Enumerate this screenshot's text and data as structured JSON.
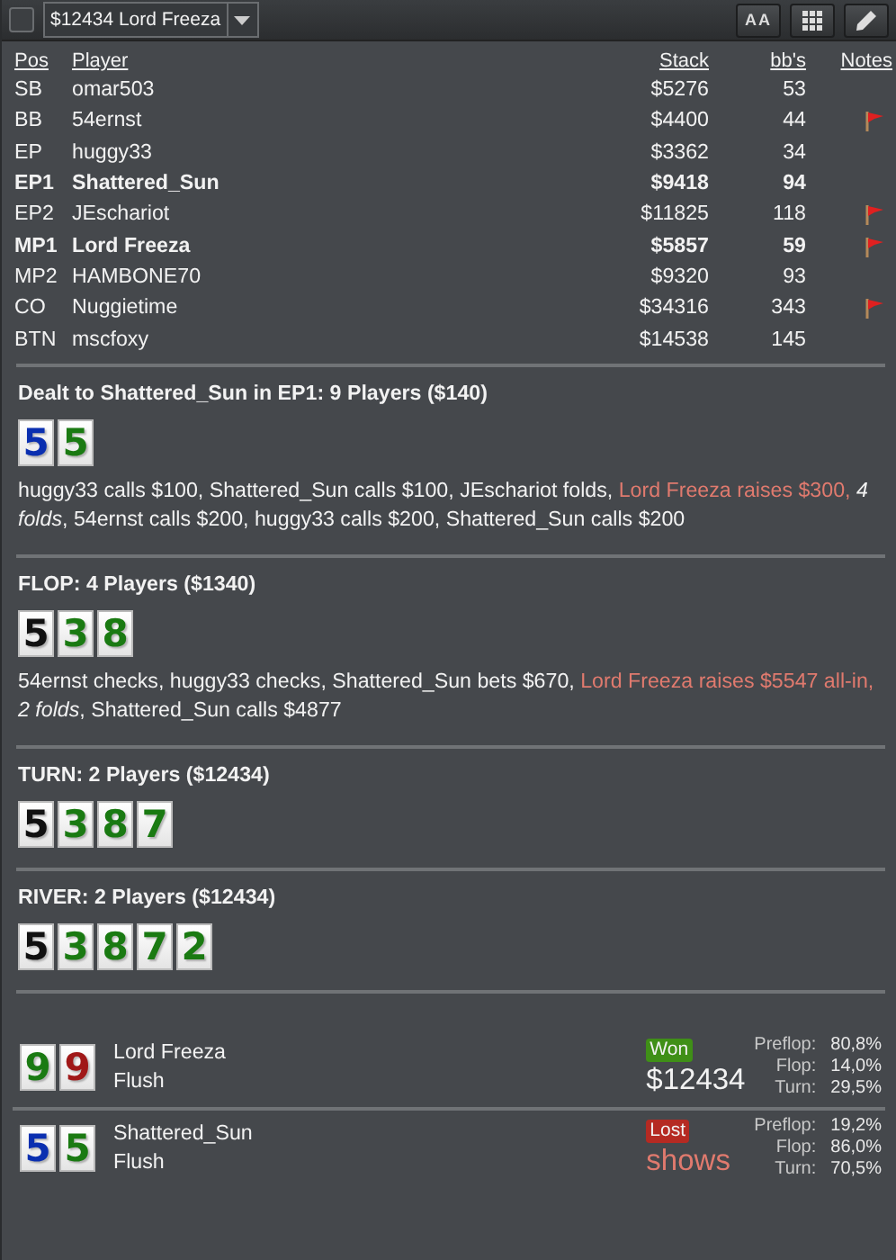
{
  "toolbar": {
    "checkbox": {
      "checked": false
    },
    "hand_select": {
      "value": "$12434 Lord Freeza"
    },
    "font_button": "AA"
  },
  "players": {
    "columns": [
      "Pos",
      "Player",
      "Stack",
      "bb's",
      "Notes"
    ],
    "rows": [
      {
        "pos": "SB",
        "player": "omar503",
        "stack": "$5276",
        "bbs": "53",
        "flagged": false,
        "highlighted": false
      },
      {
        "pos": "BB",
        "player": "54ernst",
        "stack": "$4400",
        "bbs": "44",
        "flagged": true,
        "highlighted": false
      },
      {
        "pos": "EP",
        "player": "huggy33",
        "stack": "$3362",
        "bbs": "34",
        "flagged": false,
        "highlighted": false
      },
      {
        "pos": "EP1",
        "player": "Shattered_Sun",
        "stack": "$9418",
        "bbs": "94",
        "flagged": false,
        "highlighted": true
      },
      {
        "pos": "EP2",
        "player": "JEschariot",
        "stack": "$11825",
        "bbs": "118",
        "flagged": true,
        "highlighted": false
      },
      {
        "pos": "MP1",
        "player": "Lord Freeza",
        "stack": "$5857",
        "bbs": "59",
        "flagged": true,
        "highlighted": true
      },
      {
        "pos": "MP2",
        "player": "HAMBONE70",
        "stack": "$9320",
        "bbs": "93",
        "flagged": false,
        "highlighted": false
      },
      {
        "pos": "CO",
        "player": "Nuggietime",
        "stack": "$34316",
        "bbs": "343",
        "flagged": true,
        "highlighted": false
      },
      {
        "pos": "BTN",
        "player": "mscfoxy",
        "stack": "$14538",
        "bbs": "145",
        "flagged": false,
        "highlighted": false
      }
    ]
  },
  "streets": [
    {
      "title": "Dealt to Shattered_Sun in EP1: 9 Players ($140)",
      "cards": [
        {
          "rank": "5",
          "color": "#0a2fb0"
        },
        {
          "rank": "5",
          "color": "#1a7a12"
        }
      ],
      "actions": [
        {
          "text": "huggy33 calls $100, Shattered_Sun calls $100, JEschariot folds, ",
          "kind": "normal"
        },
        {
          "text": "Lord Freeza raises $300, ",
          "kind": "raise"
        },
        {
          "text": "4 folds",
          "kind": "folds"
        },
        {
          "text": ", 54ernst calls $200, huggy33 calls $200, Shattered_Sun calls $200",
          "kind": "normal"
        }
      ]
    },
    {
      "title": "FLOP: 4 Players ($1340)",
      "cards": [
        {
          "rank": "5",
          "color": "#111111"
        },
        {
          "rank": "3",
          "color": "#1a7a12"
        },
        {
          "rank": "8",
          "color": "#1a7a12"
        }
      ],
      "actions": [
        {
          "text": "54ernst checks, huggy33 checks, Shattered_Sun bets $670, ",
          "kind": "normal"
        },
        {
          "text": "Lord Freeza raises $5547 all-in, ",
          "kind": "raise"
        },
        {
          "text": "2 folds",
          "kind": "folds"
        },
        {
          "text": ", Shattered_Sun calls $4877",
          "kind": "normal"
        }
      ]
    },
    {
      "title": "TURN: 2 Players ($12434)",
      "cards": [
        {
          "rank": "5",
          "color": "#111111"
        },
        {
          "rank": "3",
          "color": "#1a7a12"
        },
        {
          "rank": "8",
          "color": "#1a7a12"
        },
        {
          "rank": "7",
          "color": "#1a7a12"
        }
      ]
    },
    {
      "title": "RIVER: 2 Players ($12434)",
      "cards": [
        {
          "rank": "5",
          "color": "#111111"
        },
        {
          "rank": "3",
          "color": "#1a7a12"
        },
        {
          "rank": "8",
          "color": "#1a7a12"
        },
        {
          "rank": "7",
          "color": "#1a7a12"
        },
        {
          "rank": "2",
          "color": "#1a7a12"
        }
      ]
    }
  ],
  "results": [
    {
      "cards": [
        {
          "rank": "9",
          "color": "#1a7a12"
        },
        {
          "rank": "9",
          "color": "#a01818"
        }
      ],
      "player": "Lord Freeza",
      "hand": "Flush",
      "outcome": "Won",
      "won": true,
      "amount": "$12434",
      "equity": [
        {
          "label": "Preflop:",
          "value": "80,8%"
        },
        {
          "label": "Flop:",
          "value": "14,0%"
        },
        {
          "label": "Turn:",
          "value": "29,5%"
        }
      ]
    },
    {
      "cards": [
        {
          "rank": "5",
          "color": "#0a2fb0"
        },
        {
          "rank": "5",
          "color": "#1a7a12"
        }
      ],
      "player": "Shattered_Sun",
      "hand": "Flush",
      "outcome": "Lost",
      "won": false,
      "amount": "shows",
      "equity": [
        {
          "label": "Preflop:",
          "value": "19,2%"
        },
        {
          "label": "Flop:",
          "value": "86,0%"
        },
        {
          "label": "Turn:",
          "value": "70,5%"
        }
      ]
    }
  ]
}
